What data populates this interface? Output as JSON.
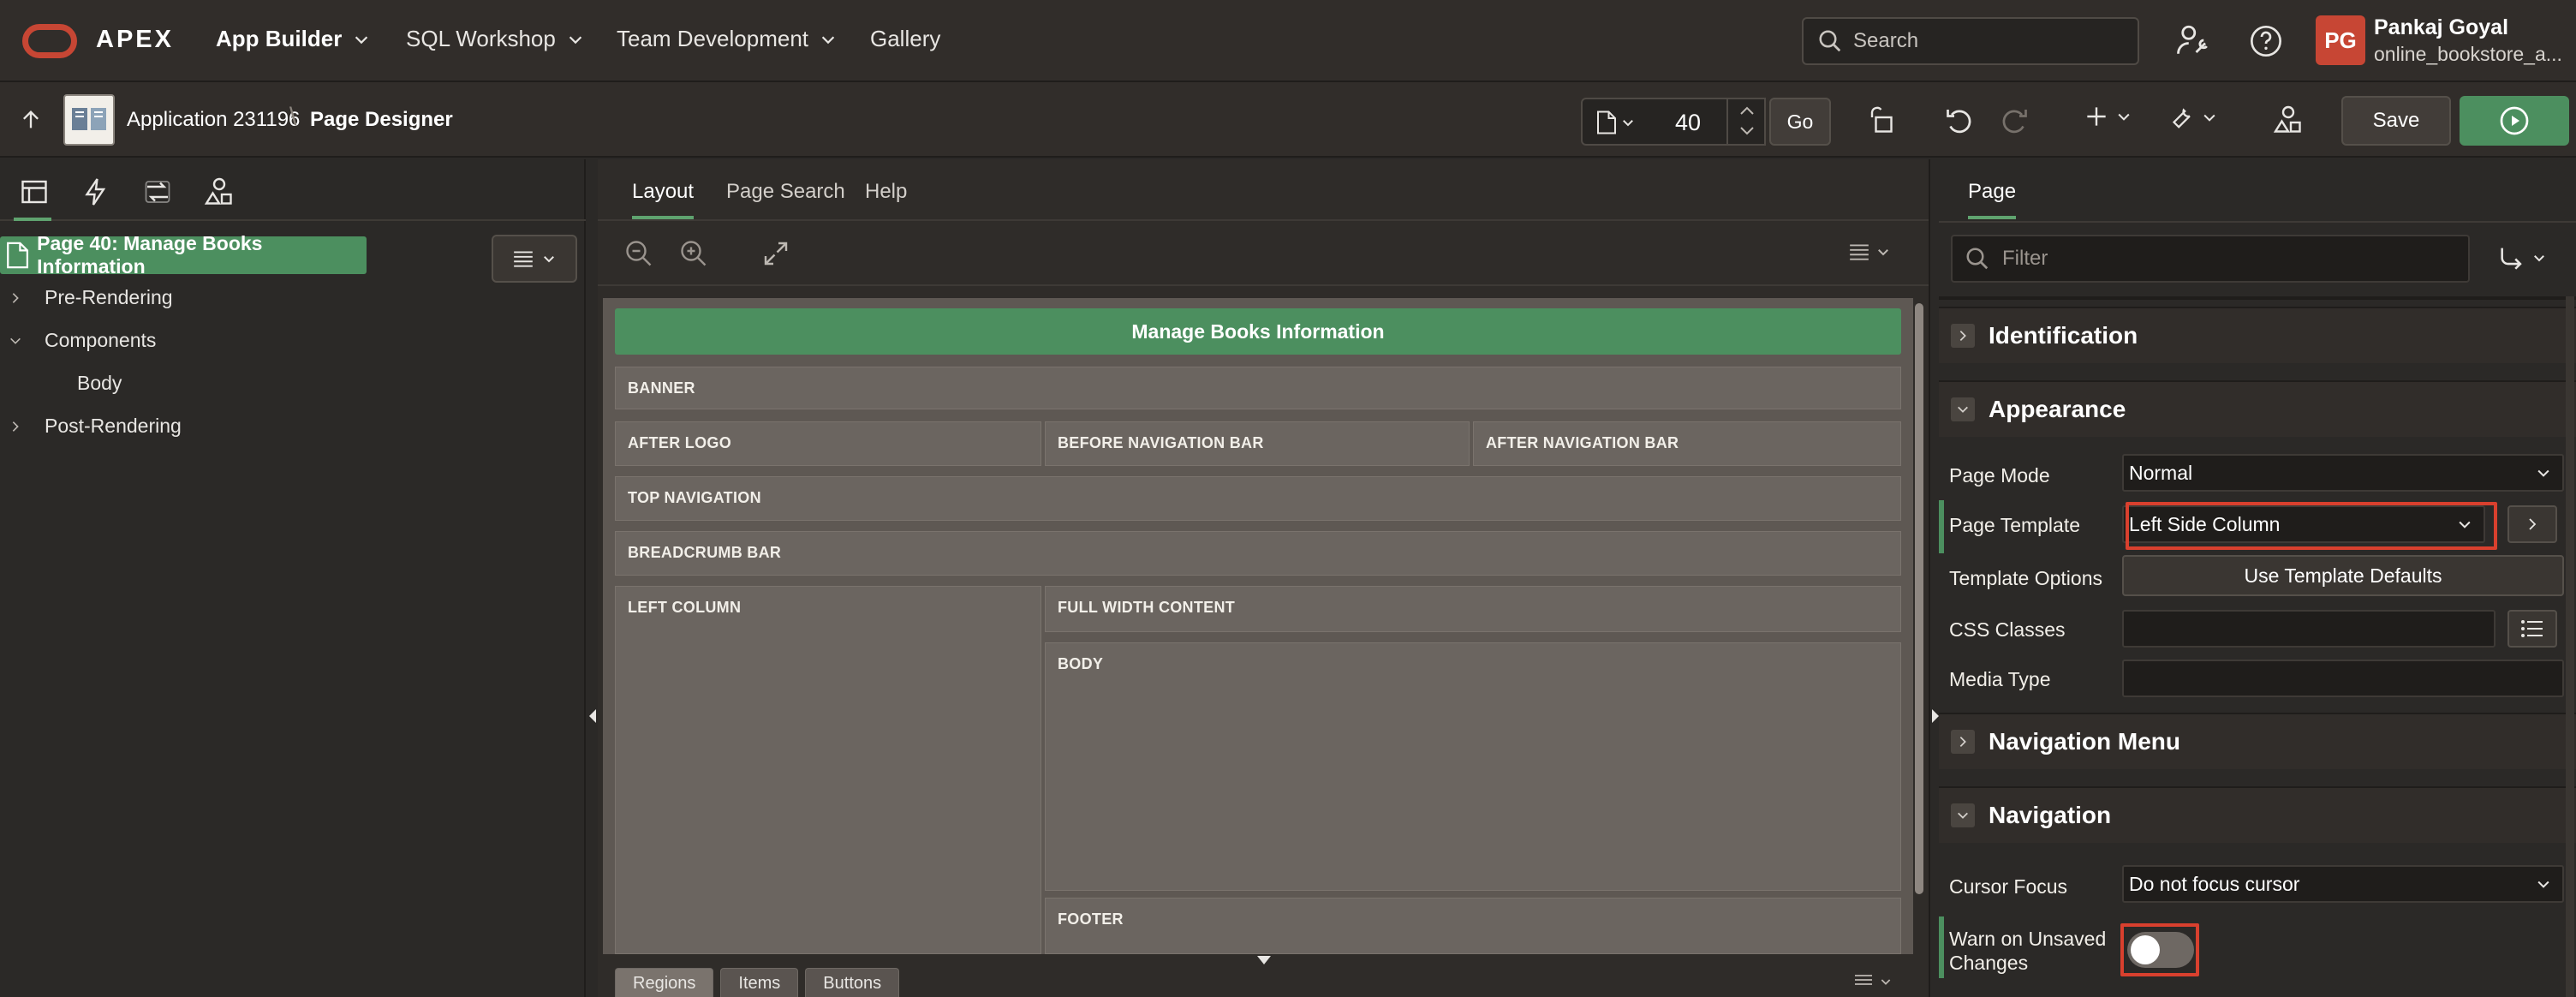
{
  "topbar": {
    "brand": "APEX",
    "nav": [
      {
        "label": "App Builder",
        "has_menu": true,
        "active": true
      },
      {
        "label": "SQL Workshop",
        "has_menu": true
      },
      {
        "label": "Team Development",
        "has_menu": true
      },
      {
        "label": "Gallery",
        "has_menu": false
      }
    ],
    "search_placeholder": "Search",
    "user": {
      "initials": "PG",
      "name": "Pankaj Goyal",
      "workspace": "online_bookstore_a..."
    }
  },
  "toolbar": {
    "breadcrumb_app": "Application 231196",
    "breadcrumb_sep": "\\",
    "breadcrumb_page": "Page Designer",
    "page_number": "40",
    "go_label": "Go",
    "save_label": "Save"
  },
  "left_panel": {
    "selected_page": "Page 40: Manage Books Information",
    "tree": [
      "Pre-Rendering",
      "Components",
      "Body",
      "Post-Rendering"
    ]
  },
  "center_panel": {
    "tabs": [
      "Layout",
      "Page Search",
      "Help"
    ],
    "page_title": "Manage Books Information",
    "regions": {
      "banner": "BANNER",
      "after_logo": "AFTER LOGO",
      "before_nav": "BEFORE NAVIGATION BAR",
      "after_nav": "AFTER NAVIGATION BAR",
      "top_nav": "TOP NAVIGATION",
      "breadcrumb": "BREADCRUMB BAR",
      "left_column": "LEFT COLUMN",
      "full_width": "FULL WIDTH CONTENT",
      "body": "BODY",
      "footer": "FOOTER"
    },
    "bottom_tabs": [
      "Regions",
      "Items",
      "Buttons"
    ]
  },
  "right_panel": {
    "tab": "Page",
    "filter_placeholder": "Filter",
    "sections": {
      "identification": "Identification",
      "appearance": "Appearance",
      "navigation_menu": "Navigation Menu",
      "navigation": "Navigation"
    },
    "props": {
      "page_mode_label": "Page Mode",
      "page_mode_value": "Normal",
      "page_template_label": "Page Template",
      "page_template_value": "Left Side Column",
      "template_options_label": "Template Options",
      "template_options_button": "Use Template Defaults",
      "css_classes_label": "CSS Classes",
      "media_type_label": "Media Type",
      "cursor_focus_label": "Cursor Focus",
      "cursor_focus_value": "Do not focus cursor",
      "warn_unsaved_label_1": "Warn on Unsaved",
      "warn_unsaved_label_2": "Changes",
      "warn_unsaved_value": false
    }
  },
  "colors": {
    "accent_green": "#4c8f5f",
    "brand_red": "#c74634",
    "highlight_red": "#d9402e"
  }
}
